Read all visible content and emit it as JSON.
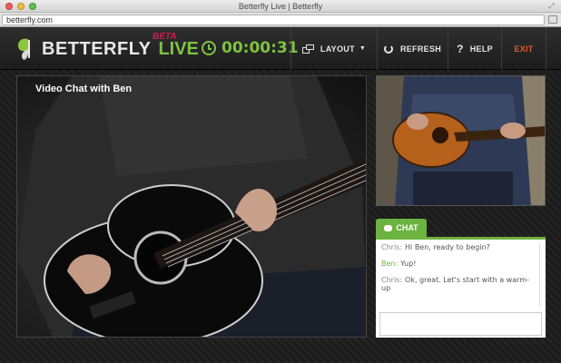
{
  "browser": {
    "window_title": "Betterfly Live | Betterfly",
    "url": "betterfly.com"
  },
  "header": {
    "logo_text": "BETTERFLY",
    "logo_live": "LIVE",
    "logo_beta": "BETA",
    "timer": "00:00:31",
    "nav": {
      "layout": "LAYOUT",
      "refresh": "REFRESH",
      "help": "HELP",
      "exit": "EXIT"
    }
  },
  "main_video": {
    "title": "Video Chat with Ben"
  },
  "chat": {
    "tab_label": "CHAT",
    "messages": [
      {
        "sender": "Chris:",
        "text": "Hi Ben, ready to begin?"
      },
      {
        "sender": "Ben:",
        "text": "Yup!"
      },
      {
        "sender": "Chris:",
        "text": "Ok, great. Let's start with a warm-up"
      }
    ],
    "input_value": ""
  },
  "colors": {
    "accent_green": "#7ec242",
    "exit_orange": "#e35a2b",
    "beta_red": "#c8204e"
  }
}
